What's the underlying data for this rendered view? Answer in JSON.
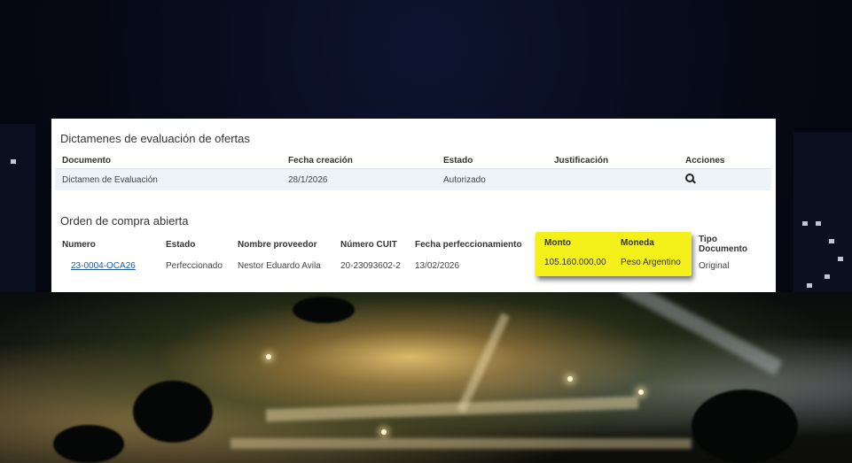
{
  "dictamenes": {
    "title": "Dictamenes de evaluación de ofertas",
    "columns": [
      "Documento",
      "Fecha creación",
      "Estado",
      "Justificación",
      "Acciones"
    ],
    "rows": [
      {
        "documento": "Dictamen de Evaluación",
        "fecha": "28/1/2026",
        "estado": "Autorizado",
        "justificacion": "",
        "accion_icon": "search-icon"
      }
    ]
  },
  "orden": {
    "title": "Orden de compra abierta",
    "columns": [
      "Numero",
      "Estado",
      "Nombre proveedor",
      "Número CUIT",
      "Fecha perfeccionamiento",
      "Monto",
      "Moneda",
      "Tipo Documento"
    ],
    "rows": [
      {
        "numero": "23-0004-OCA26",
        "estado": "Perfeccionado",
        "proveedor": "Nestor Eduardo Avila",
        "cuit": "20-23093602-2",
        "fecha": "13/02/2026",
        "monto": "105.160.000,00",
        "moneda": "Peso Argentino",
        "tipo": "Original"
      }
    ]
  },
  "colors": {
    "highlight": "#f4f01a",
    "link": "#1c5aa8"
  }
}
